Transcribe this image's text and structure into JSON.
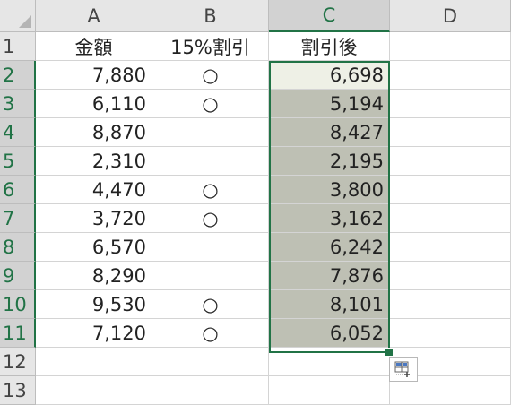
{
  "columns": [
    "A",
    "B",
    "C",
    "D"
  ],
  "rows": [
    "1",
    "2",
    "3",
    "4",
    "5",
    "6",
    "7",
    "8",
    "9",
    "10",
    "11",
    "12",
    "13"
  ],
  "headers": {
    "a": "金額",
    "b": "15%割引",
    "c": "割引後"
  },
  "data_rows": [
    {
      "amount": "7,880",
      "discount": "○",
      "after": "6,698"
    },
    {
      "amount": "6,110",
      "discount": "○",
      "after": "5,194"
    },
    {
      "amount": "8,870",
      "discount": "",
      "after": "8,427"
    },
    {
      "amount": "2,310",
      "discount": "",
      "after": "2,195"
    },
    {
      "amount": "4,470",
      "discount": "○",
      "after": "3,800"
    },
    {
      "amount": "3,720",
      "discount": "○",
      "after": "3,162"
    },
    {
      "amount": "6,570",
      "discount": "",
      "after": "6,242"
    },
    {
      "amount": "8,290",
      "discount": "",
      "after": "7,876"
    },
    {
      "amount": "9,530",
      "discount": "○",
      "after": "8,101"
    },
    {
      "amount": "7,120",
      "discount": "○",
      "after": "6,052"
    }
  ],
  "selection": {
    "range": "C2:C11",
    "active_cell": "C2",
    "selected_column": "C"
  },
  "colors": {
    "accent": "#217346",
    "selected_fill": "#bec0b4",
    "active_fill": "#eef0e6",
    "header_fill": "#e6e6e6"
  },
  "icons": {
    "quick_analysis": "quick-analysis-icon",
    "select_all": "select-all-triangle-icon"
  }
}
